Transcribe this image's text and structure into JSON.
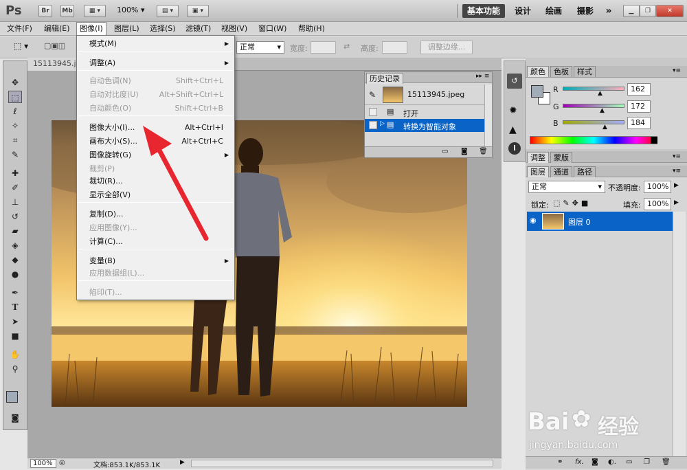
{
  "app": {
    "logo": "Ps",
    "bridge_btn": "Br",
    "minibridge_btn": "Mb",
    "zoom": "100%",
    "workspaces": [
      "基本功能",
      "设计",
      "绘画",
      "摄影"
    ],
    "more": "»"
  },
  "menubar": [
    "文件(F)",
    "编辑(E)",
    "图像(I)",
    "图层(L)",
    "选择(S)",
    "滤镜(T)",
    "视图(V)",
    "窗口(W)",
    "帮助(H)"
  ],
  "options": {
    "mode": "正常",
    "width_label": "宽度:",
    "height_label": "高度:",
    "refine_btn": "调整边缘..."
  },
  "document": {
    "tab": "15113945.jpe",
    "zoom": "100%",
    "status": "文档:853.1K/853.1K"
  },
  "image_menu": {
    "items": [
      {
        "label": "模式(M)",
        "shortcut": "",
        "submenu": true,
        "disabled": false
      },
      {
        "label": "调整(A)",
        "shortcut": "",
        "submenu": true,
        "disabled": false
      },
      {
        "label": "自动色调(N)",
        "shortcut": "Shift+Ctrl+L",
        "submenu": false,
        "disabled": true
      },
      {
        "label": "自动对比度(U)",
        "shortcut": "Alt+Shift+Ctrl+L",
        "submenu": false,
        "disabled": true
      },
      {
        "label": "自动颜色(O)",
        "shortcut": "Shift+Ctrl+B",
        "submenu": false,
        "disabled": true
      },
      {
        "label": "图像大小(I)...",
        "shortcut": "Alt+Ctrl+I",
        "submenu": false,
        "disabled": false
      },
      {
        "label": "画布大小(S)...",
        "shortcut": "Alt+Ctrl+C",
        "submenu": false,
        "disabled": false
      },
      {
        "label": "图像旋转(G)",
        "shortcut": "",
        "submenu": true,
        "disabled": false
      },
      {
        "label": "裁剪(P)",
        "shortcut": "",
        "submenu": false,
        "disabled": true
      },
      {
        "label": "裁切(R)...",
        "shortcut": "",
        "submenu": false,
        "disabled": false
      },
      {
        "label": "显示全部(V)",
        "shortcut": "",
        "submenu": false,
        "disabled": false
      },
      {
        "label": "复制(D)...",
        "shortcut": "",
        "submenu": false,
        "disabled": false
      },
      {
        "label": "应用图像(Y)...",
        "shortcut": "",
        "submenu": false,
        "disabled": true
      },
      {
        "label": "计算(C)...",
        "shortcut": "",
        "submenu": false,
        "disabled": false
      },
      {
        "label": "变量(B)",
        "shortcut": "",
        "submenu": true,
        "disabled": false
      },
      {
        "label": "应用数据组(L)...",
        "shortcut": "",
        "submenu": false,
        "disabled": true
      },
      {
        "label": "陷印(T)...",
        "shortcut": "",
        "submenu": false,
        "disabled": true
      }
    ]
  },
  "history": {
    "tab": "历史记录",
    "snapshot": "15113945.jpeg",
    "steps": [
      "打开",
      "转换为智能对象"
    ]
  },
  "color_panel": {
    "tabs": [
      "颜色",
      "色板",
      "样式"
    ],
    "r_label": "R",
    "g_label": "G",
    "b_label": "B",
    "r": "162",
    "g": "172",
    "b": "184",
    "r_frac": 0.64,
    "g_frac": 0.67,
    "b_frac": 0.72
  },
  "adjust_tabs": [
    "调整",
    "蒙版"
  ],
  "layers_panel": {
    "tabs": [
      "图层",
      "通道",
      "路径"
    ],
    "blend_mode": "正常",
    "opacity_label": "不透明度:",
    "opacity": "100%",
    "lock_label": "锁定:",
    "fill_label": "填充:",
    "fill": "100%",
    "layer_name": "图层 0"
  },
  "watermark": {
    "brand": "Bai",
    "brand2": "经验",
    "url": "jingyan.baidu.com"
  },
  "colors": {
    "accent": "#0a64c8",
    "arrow": "#e8262f"
  }
}
